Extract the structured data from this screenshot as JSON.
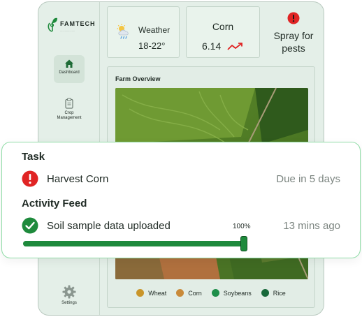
{
  "brand": {
    "name": "FAMTECH",
    "tagline": "..................."
  },
  "sidebar": {
    "items": [
      {
        "label": "Dashboard",
        "icon": "home-icon",
        "active": true
      },
      {
        "label": "Crop Management",
        "icon": "clipboard-icon",
        "active": false
      },
      {
        "label": "Settings",
        "icon": "gear-icon",
        "active": false
      }
    ]
  },
  "weather": {
    "label": "Weather",
    "temp": "18-22°",
    "icon": "cloud-sun-rain-icon"
  },
  "market": {
    "crop": "Corn",
    "price": "6.14",
    "trend": "up",
    "trend_color": "#e02424"
  },
  "alert": {
    "text": "Spray for pests",
    "icon": "alert-icon",
    "color": "#e02424"
  },
  "overview": {
    "title": "Farm Overview",
    "legend": [
      {
        "name": "Wheat",
        "color": "#c9952a"
      },
      {
        "name": "Corn",
        "color": "#c98a3a"
      },
      {
        "name": "Soybeans",
        "color": "#1e8f4a"
      },
      {
        "name": "Rice",
        "color": "#17683a"
      }
    ]
  },
  "task": {
    "title": "Task",
    "item": "Harvest Corn",
    "due": "Due in 5 days",
    "icon": "alert-icon",
    "icon_color": "#e02424"
  },
  "activity": {
    "title": "Activity Feed",
    "item": "Soil sample data uploaded",
    "time": "13 mins ago",
    "icon": "check-circle-icon",
    "icon_color": "#1e8a3c",
    "progress": 100,
    "progress_label": "100%"
  }
}
